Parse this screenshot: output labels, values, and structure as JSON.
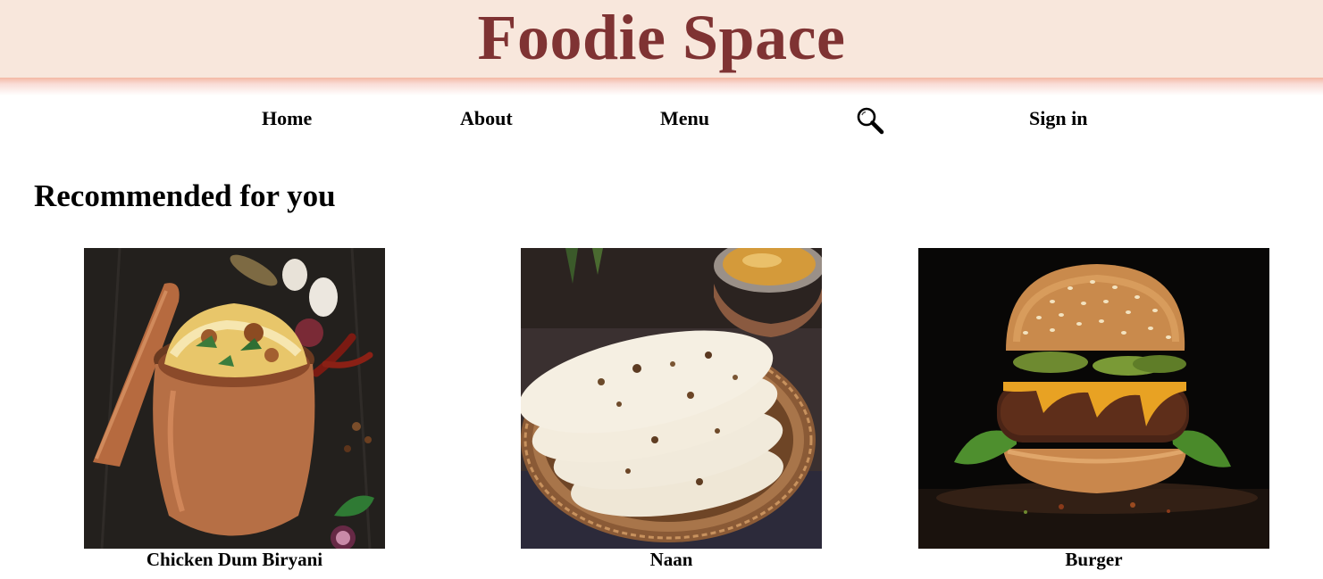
{
  "header": {
    "brand": "Foodie Space",
    "brand_color": "#7f3333",
    "background_color": "#f8e7dc"
  },
  "nav": {
    "items": [
      {
        "label": "Home"
      },
      {
        "label": "About"
      },
      {
        "label": "Menu"
      },
      {
        "icon": "search-icon"
      },
      {
        "label": "Sign in"
      }
    ]
  },
  "section": {
    "title": "Recommended for you"
  },
  "cards": [
    {
      "caption": "Chicken Dum Biryani",
      "image": "chicken-dum-biryani-photo"
    },
    {
      "caption": "Naan",
      "image": "naan-photo"
    },
    {
      "caption": "Burger",
      "image": "burger-photo"
    }
  ]
}
